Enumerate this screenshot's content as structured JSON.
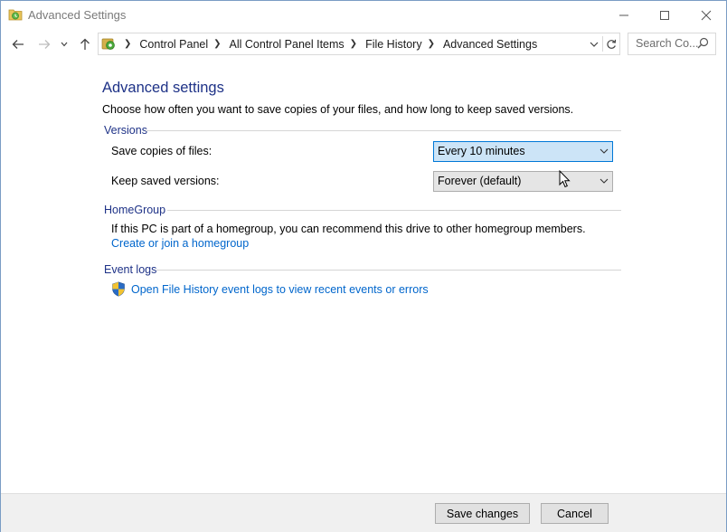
{
  "window": {
    "title": "Advanced Settings"
  },
  "address_bar": {
    "crumbs": [
      "Control Panel",
      "All Control Panel Items",
      "File History",
      "Advanced Settings"
    ],
    "search_placeholder": "Search Co..."
  },
  "main": {
    "heading": "Advanced settings",
    "intro": "Choose how often you want to save copies of your files, and how long to keep saved versions.",
    "versions": {
      "title": "Versions",
      "save_copies_label": "Save copies of files:",
      "save_copies_value": "Every 10 minutes",
      "keep_versions_label": "Keep saved versions:",
      "keep_versions_value": "Forever (default)"
    },
    "homegroup": {
      "title": "HomeGroup",
      "text": "If this PC is part of a homegroup, you can recommend this drive to other homegroup members.",
      "link": "Create or join a homegroup"
    },
    "event_logs": {
      "title": "Event logs",
      "link": "Open File History event logs to view recent events or errors"
    }
  },
  "footer": {
    "save_label": "Save changes",
    "cancel_label": "Cancel"
  },
  "colors": {
    "heading": "#1e3287",
    "link": "#0066cc",
    "focus_fill": "#cce4f7",
    "focus_border": "#0078d7"
  }
}
